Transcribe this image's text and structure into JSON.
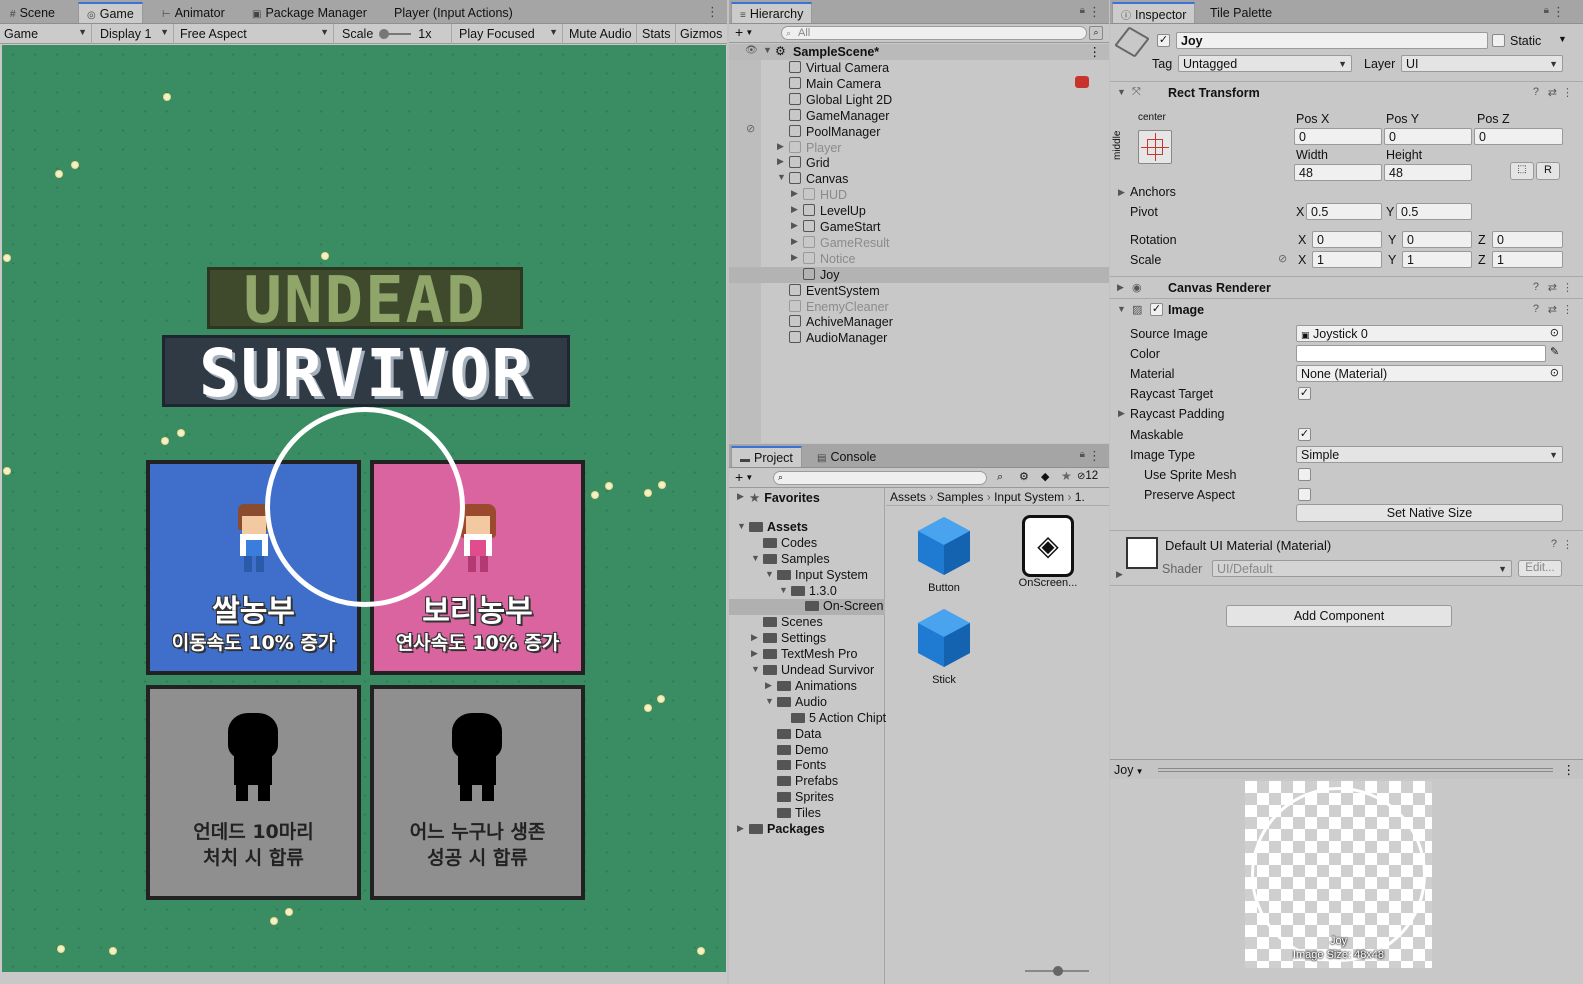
{
  "game_panel": {
    "tabs": [
      "Scene",
      "Game",
      "Animator",
      "Package Manager",
      "Player (Input Actions)"
    ],
    "active_tab": "Game",
    "toolbar": {
      "view": "Game",
      "display": "Display 1",
      "aspect": "Free Aspect",
      "scale_label": "Scale",
      "scale_value": "1x",
      "play_mode": "Play Focused",
      "mute": "Mute Audio",
      "stats": "Stats",
      "gizmos": "Gizmos"
    },
    "game_view": {
      "title_line1": "UNDEAD",
      "title_line2": "SURVIVOR",
      "cards": [
        {
          "name": "쌀농부",
          "desc": "이동속도 10% 증가",
          "color": "#3f6fcb"
        },
        {
          "name": "보리농부",
          "desc": "연사속도 10% 증가",
          "color": "#d9649f"
        },
        {
          "line1": "언데드 10마리",
          "line2": "처치 시 합류",
          "color": "#8f8f8f"
        },
        {
          "line1": "어느 누구나 생존",
          "line2": "성공 시 합류",
          "color": "#8f8f8f"
        }
      ],
      "grass_color": "#3a8d63"
    }
  },
  "hierarchy": {
    "tab": "Hierarchy",
    "search_placeholder": "All",
    "scene": "SampleScene*",
    "items": [
      {
        "label": "Virtual Camera",
        "depth": 1,
        "dim": false,
        "arrow": ""
      },
      {
        "label": "Main Camera",
        "depth": 1,
        "dim": false,
        "arrow": ""
      },
      {
        "label": "Global Light 2D",
        "depth": 1,
        "dim": false,
        "arrow": ""
      },
      {
        "label": "GameManager",
        "depth": 1,
        "dim": false,
        "arrow": ""
      },
      {
        "label": "PoolManager",
        "depth": 1,
        "dim": false,
        "arrow": ""
      },
      {
        "label": "Player",
        "depth": 1,
        "dim": true,
        "arrow": "▶"
      },
      {
        "label": "Grid",
        "depth": 1,
        "dim": false,
        "arrow": "▶"
      },
      {
        "label": "Canvas",
        "depth": 1,
        "dim": false,
        "arrow": "▼"
      },
      {
        "label": "HUD",
        "depth": 2,
        "dim": true,
        "arrow": "▶"
      },
      {
        "label": "LevelUp",
        "depth": 2,
        "dim": false,
        "arrow": "▶"
      },
      {
        "label": "GameStart",
        "depth": 2,
        "dim": false,
        "arrow": "▶"
      },
      {
        "label": "GameResult",
        "depth": 2,
        "dim": true,
        "arrow": "▶"
      },
      {
        "label": "Notice",
        "depth": 2,
        "dim": true,
        "arrow": "▶"
      },
      {
        "label": "Joy",
        "depth": 2,
        "dim": false,
        "arrow": "",
        "selected": true
      },
      {
        "label": "EventSystem",
        "depth": 1,
        "dim": false,
        "arrow": ""
      },
      {
        "label": "EnemyCleaner",
        "depth": 1,
        "dim": true,
        "arrow": ""
      },
      {
        "label": "AchiveManager",
        "depth": 1,
        "dim": false,
        "arrow": ""
      },
      {
        "label": "AudioManager",
        "depth": 1,
        "dim": false,
        "arrow": ""
      }
    ]
  },
  "project": {
    "tabs": [
      "Project",
      "Console"
    ],
    "hidden_count": "12",
    "breadcrumb": [
      "Assets",
      "Samples",
      "Input System",
      "1."
    ],
    "tree": [
      {
        "label": "Favorites",
        "depth": 0,
        "arrow": "▶",
        "bold": true,
        "star": true
      },
      {
        "label": "Assets",
        "depth": 0,
        "arrow": "▼",
        "bold": true
      },
      {
        "label": "Codes",
        "depth": 1,
        "arrow": ""
      },
      {
        "label": "Samples",
        "depth": 1,
        "arrow": "▼"
      },
      {
        "label": "Input System",
        "depth": 2,
        "arrow": "▼"
      },
      {
        "label": "1.3.0",
        "depth": 3,
        "arrow": "▼"
      },
      {
        "label": "On-Screen",
        "depth": 4,
        "arrow": "",
        "selected": true
      },
      {
        "label": "Scenes",
        "depth": 1,
        "arrow": ""
      },
      {
        "label": "Settings",
        "depth": 1,
        "arrow": "▶"
      },
      {
        "label": "TextMesh Pro",
        "depth": 1,
        "arrow": "▶"
      },
      {
        "label": "Undead Survivor",
        "depth": 1,
        "arrow": "▼"
      },
      {
        "label": "Animations",
        "depth": 2,
        "arrow": "▶"
      },
      {
        "label": "Audio",
        "depth": 2,
        "arrow": "▼"
      },
      {
        "label": "5 Action Chipt",
        "depth": 3,
        "arrow": ""
      },
      {
        "label": "Data",
        "depth": 2,
        "arrow": ""
      },
      {
        "label": "Demo",
        "depth": 2,
        "arrow": ""
      },
      {
        "label": "Fonts",
        "depth": 2,
        "arrow": ""
      },
      {
        "label": "Prefabs",
        "depth": 2,
        "arrow": ""
      },
      {
        "label": "Sprites",
        "depth": 2,
        "arrow": ""
      },
      {
        "label": "Tiles",
        "depth": 2,
        "arrow": ""
      },
      {
        "label": "Packages",
        "depth": 0,
        "arrow": "▶",
        "bold": true
      }
    ],
    "assets": [
      "Button",
      "OnScreen...",
      "Stick"
    ]
  },
  "inspector": {
    "tabs": [
      "Inspector",
      "Tile Palette"
    ],
    "object_name": "Joy",
    "static_label": "Static",
    "tag_label": "Tag",
    "tag": "Untagged",
    "layer_label": "Layer",
    "layer": "UI",
    "rect_transform": {
      "title": "Rect Transform",
      "anchor_h": "center",
      "anchor_v": "middle",
      "pos_x_label": "Pos X",
      "pos_x": "0",
      "pos_y_label": "Pos Y",
      "pos_y": "0",
      "pos_z_label": "Pos Z",
      "pos_z": "0",
      "width_label": "Width",
      "width": "48",
      "height_label": "Height",
      "height": "48",
      "r_btn": "R",
      "anchors_label": "Anchors",
      "pivot_label": "Pivot",
      "pivot_x": "0.5",
      "pivot_y": "0.5",
      "rotation_label": "Rotation",
      "rot_x": "0",
      "rot_y": "0",
      "rot_z": "0",
      "scale_label": "Scale",
      "scale_x": "1",
      "scale_y": "1",
      "scale_z": "1",
      "x": "X",
      "y": "Y",
      "z": "Z"
    },
    "canvas_renderer": "Canvas Renderer",
    "image": {
      "title": "Image",
      "source_image_label": "Source Image",
      "source_image": "Joystick 0",
      "color_label": "Color",
      "material_label": "Material",
      "material": "None (Material)",
      "raycast_target_label": "Raycast Target",
      "raycast_padding_label": "Raycast Padding",
      "maskable_label": "Maskable",
      "image_type_label": "Image Type",
      "image_type": "Simple",
      "use_sprite_mesh_label": "Use Sprite Mesh",
      "preserve_aspect_label": "Preserve Aspect",
      "set_native_size": "Set Native Size"
    },
    "material_block": {
      "title": "Default UI Material (Material)",
      "shader_label": "Shader",
      "shader": "UI/Default",
      "edit": "Edit..."
    },
    "add_component": "Add Component",
    "preview": {
      "dropdown": "Joy",
      "caption_name": "Joy",
      "caption_size": "Image Size: 48x48"
    }
  }
}
